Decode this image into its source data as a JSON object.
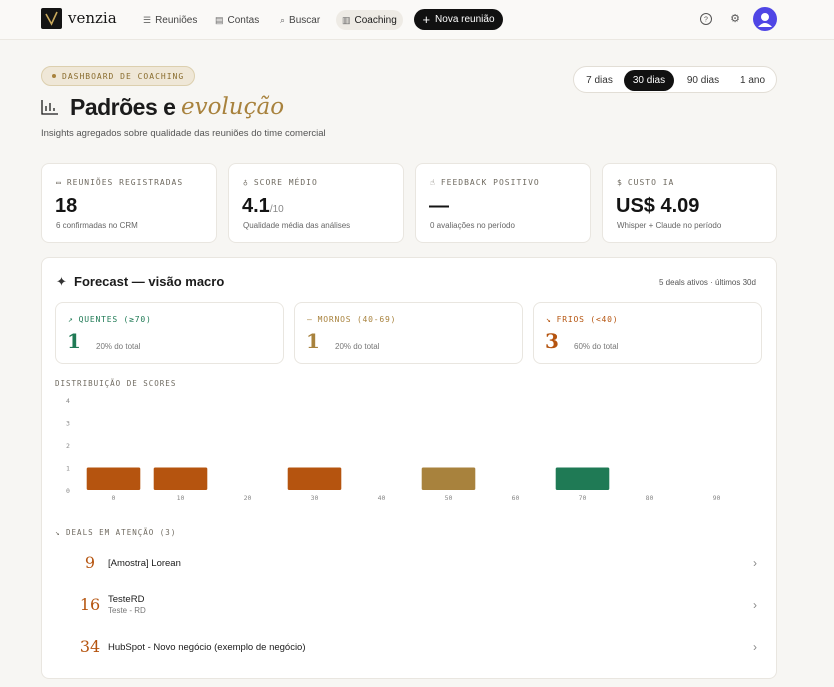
{
  "app": {
    "name": "venzia",
    "nav": [
      {
        "label": "Reuniões",
        "icon": "list-icon"
      },
      {
        "label": "Contas",
        "icon": "building-icon"
      },
      {
        "label": "Buscar",
        "icon": "search-icon"
      },
      {
        "label": "Coaching",
        "icon": "bar-chart-icon",
        "active": true
      }
    ],
    "new_button": "Nova reunião"
  },
  "header": {
    "badge": "DASHBOARD DE COACHING",
    "title": "Padrões e",
    "title_accent": "evolução",
    "subtitle": "Insights agregados sobre qualidade das reuniões do time comercial",
    "periods": [
      "7 dias",
      "30 dias",
      "90 dias",
      "1 ano"
    ],
    "active_period": "30 dias"
  },
  "kpis": [
    {
      "label": "REUNIÕES REGISTRADAS",
      "value": "18",
      "suffix": "",
      "sub": "6 confirmadas no CRM",
      "icon": "calendar-icon"
    },
    {
      "label": "SCORE MÉDIO",
      "value": "4.1",
      "suffix": "/10",
      "sub": "Qualidade média das análises",
      "icon": "award-icon"
    },
    {
      "label": "FEEDBACK POSITIVO",
      "value": "—",
      "suffix": "",
      "sub": "0 avaliações no período",
      "icon": "thumbs-up-icon"
    },
    {
      "label": "CUSTO IA",
      "value": "US$ 4.09",
      "suffix": "",
      "sub": "Whisper + Claude no período",
      "icon": "dollar-icon"
    }
  ],
  "forecast": {
    "title": "Forecast — visão macro",
    "meta": "5 deals ativos · últimos 30d",
    "segments": [
      {
        "label": "QUENTES (≥70)",
        "value": "1",
        "sub": "20% do total",
        "color": "#1f7a55",
        "icon": "trending-up-icon"
      },
      {
        "label": "MORNOS (40-69)",
        "value": "1",
        "sub": "20% do total",
        "color": "#a8823d",
        "icon": "dash-icon"
      },
      {
        "label": "FRIOS (<40)",
        "value": "3",
        "sub": "60% do total",
        "color": "#b5540f",
        "icon": "trending-down-icon"
      }
    ],
    "distribution_label": "DISTRIBUIÇÃO DE SCORES",
    "deals_label": "DEALS EM ATENÇÃO (3)",
    "deals": [
      {
        "score": "9",
        "name": "[Amostra] Lorean",
        "sub": ""
      },
      {
        "score": "16",
        "name": "TesteRD",
        "sub": "Teste - RD"
      },
      {
        "score": "34",
        "name": "HubSpot - Novo negócio (exemplo de negócio)",
        "sub": ""
      }
    ]
  },
  "chart_data": {
    "type": "bar",
    "categories": [
      "0",
      "10",
      "20",
      "30",
      "40",
      "50",
      "60",
      "70",
      "80",
      "90"
    ],
    "values": [
      1,
      1,
      0,
      1,
      0,
      1,
      0,
      1,
      0,
      0
    ],
    "colors": [
      "#b5540f",
      "#b5540f",
      "#b5540f",
      "#b5540f",
      "#b5540f",
      "#a8823d",
      "#a8823d",
      "#1f7a55",
      "#1f7a55",
      "#1f7a55"
    ],
    "yticks": [
      "0",
      "1",
      "2",
      "3",
      "4"
    ],
    "ylim": [
      0,
      4
    ],
    "title": "",
    "xlabel": "",
    "ylabel": ""
  }
}
